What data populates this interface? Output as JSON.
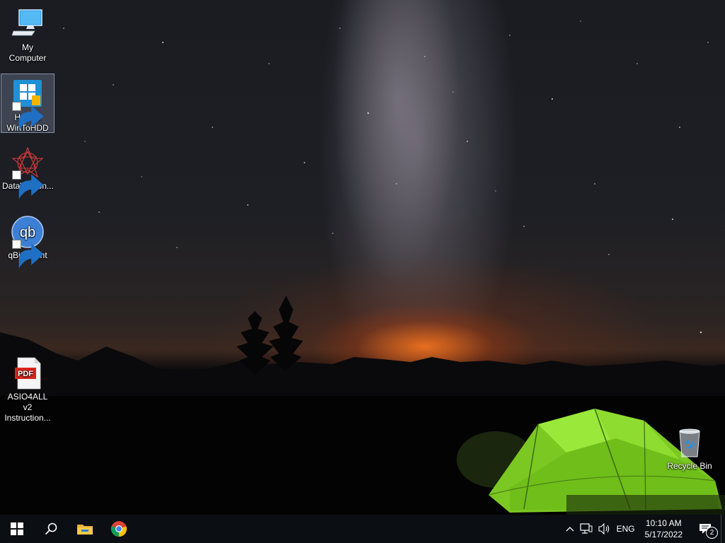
{
  "desktop": {
    "icons": [
      {
        "label": "My Computer",
        "icon": "computer-icon"
      },
      {
        "label": "Hasleo WinToHDD",
        "icon": "wintohdd-icon"
      },
      {
        "label": "DataWagon...",
        "icon": "datawagon-icon"
      },
      {
        "label": "qBittorrent",
        "icon": "qbittorrent-icon",
        "glyph": "qb"
      },
      {
        "label": "ASIO4ALL v2 Instruction...",
        "icon": "pdf-icon",
        "glyph": "PDF"
      },
      {
        "label": "Recycle Bin",
        "icon": "recycle-bin-icon"
      }
    ]
  },
  "taskbar": {
    "apps": [
      {
        "name": "Start",
        "icon": "windows-start-icon"
      },
      {
        "name": "Search",
        "icon": "search-icon"
      },
      {
        "name": "File Explorer",
        "icon": "folder-icon"
      },
      {
        "name": "Google Chrome",
        "icon": "chrome-icon"
      }
    ],
    "tray": {
      "language": "ENG",
      "time": "10:10 AM",
      "date": "5/17/2022",
      "notification_count": "2"
    }
  },
  "colors": {
    "taskbar": "#0b0e12",
    "selection": "#96aac8",
    "tent": "#8be02a"
  }
}
